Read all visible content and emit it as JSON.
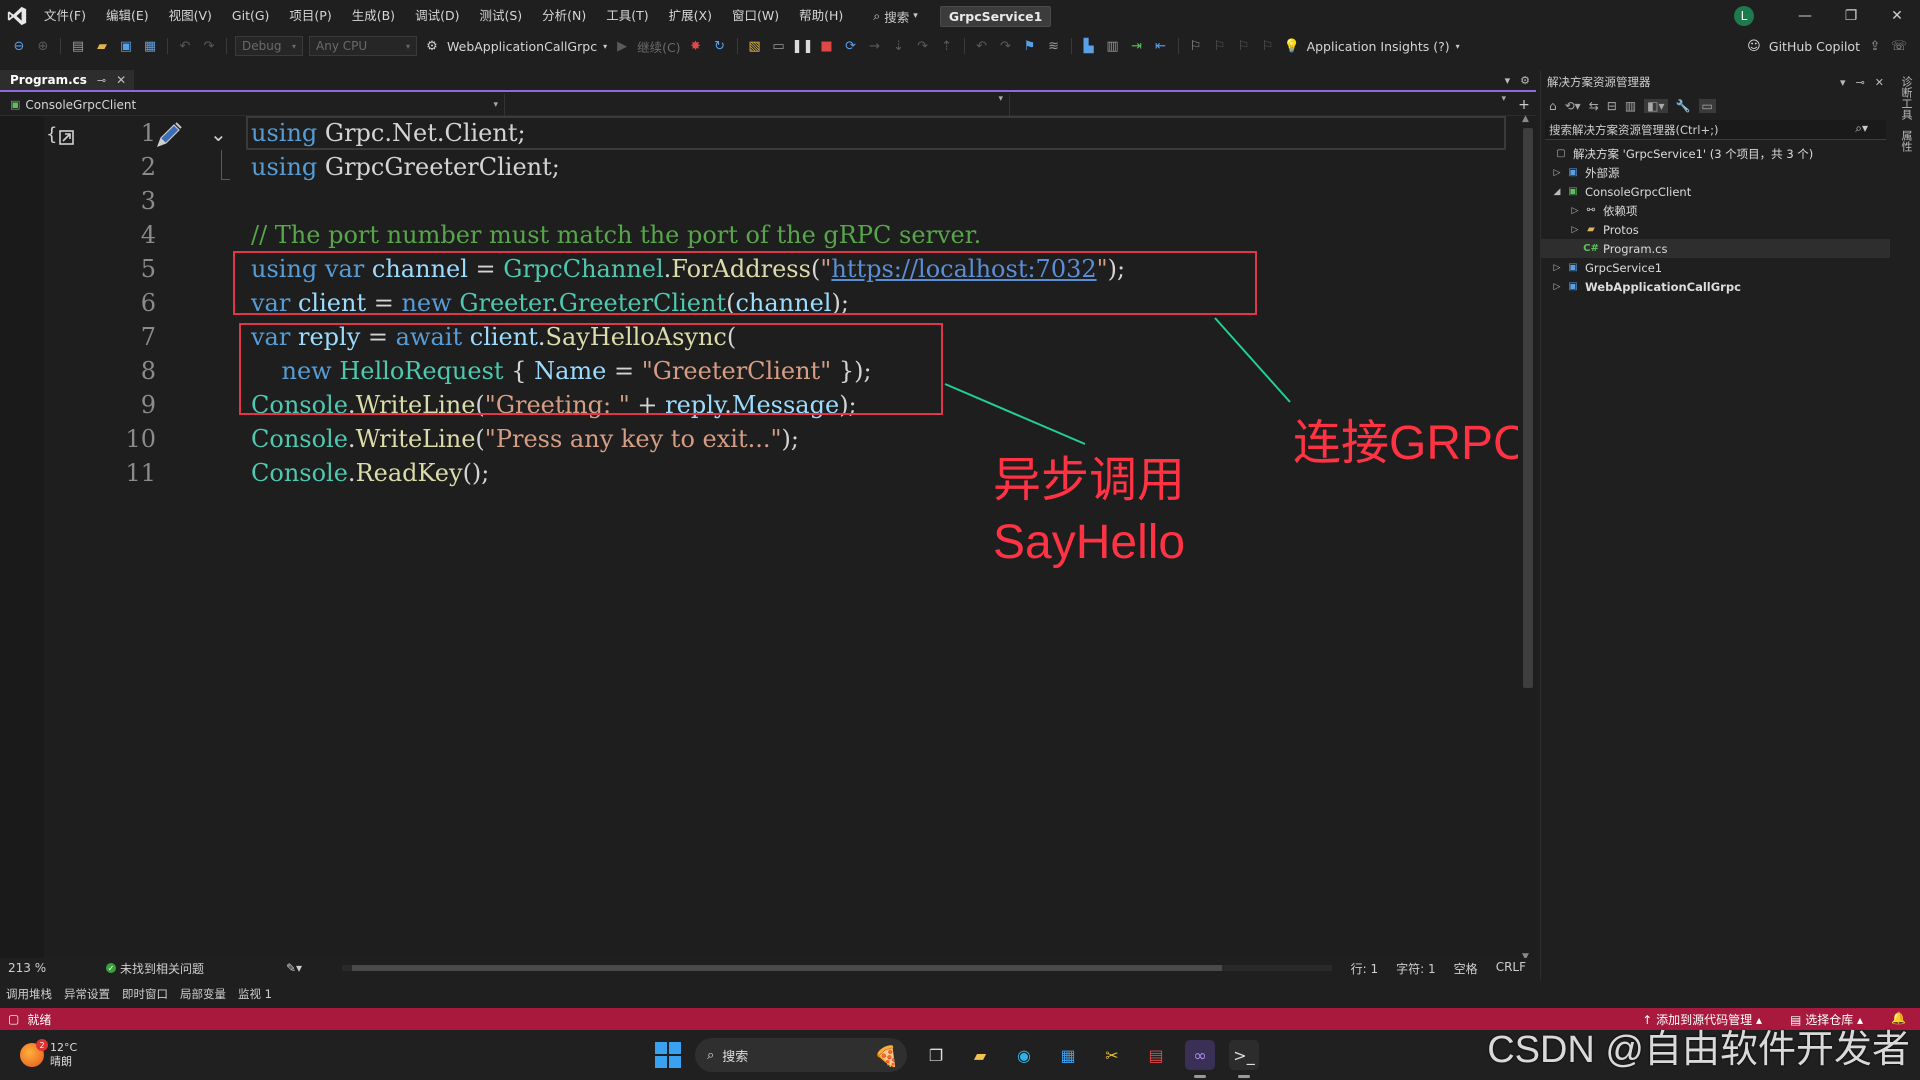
{
  "titlebar": {
    "menu": [
      "文件(F)",
      "编辑(E)",
      "视图(V)",
      "Git(G)",
      "项目(P)",
      "生成(B)",
      "调试(D)",
      "测试(S)",
      "分析(N)",
      "工具(T)",
      "扩展(X)",
      "窗口(W)",
      "帮助(H)"
    ],
    "search_label": "搜索",
    "solution_name": "GrpcService1",
    "avatar_letter": "L"
  },
  "toolbar": {
    "config": "Debug",
    "platform": "Any CPU",
    "startup_project": "WebApplicationCallGrpc",
    "continue_label": "继续(C)",
    "app_insights": "Application Insights (?)",
    "copilot": "GitHub Copilot"
  },
  "editor": {
    "tab_name": "Program.cs",
    "nav_project": "ConsoleGrpcClient",
    "line_numbers": [
      "1",
      "2",
      "3",
      "4",
      "5",
      "6",
      "7",
      "8",
      "9",
      "10",
      "11"
    ],
    "code": {
      "l1_kw": "using",
      "l1_rest": " Grpc.Net.Client;",
      "l2_kw": "using",
      "l2_rest": " GrpcGreeterClient;",
      "l4_comment": "// The port number must match the port of the gRPC server.",
      "l5_using": "using",
      "l5_var": "var",
      "l5_channel": "channel",
      "l5_eq": " = ",
      "l5_type": "GrpcChannel",
      "l5_method": "ForAddress",
      "l5_url": "https://localhost:7032",
      "l6_var": "var",
      "l6_client": "client",
      "l6_new": "new",
      "l6_type1": "Greeter",
      "l6_type2": "GreeterClient",
      "l6_arg": "channel",
      "l7_var": "var",
      "l7_reply": "reply",
      "l7_await": "await",
      "l7_client": "client",
      "l7_method": "SayHelloAsync",
      "l8_new": "new",
      "l8_type": "HelloRequest",
      "l8_name": "Name",
      "l8_str": "\"GreeterClient\"",
      "l9_type": "Console",
      "l9_method": "WriteLine",
      "l9_str": "\"Greeting: \"",
      "l9_reply": "reply",
      "l9_msg": "Message",
      "l10_type": "Console",
      "l10_method": "WriteLine",
      "l10_str": "\"Press any key to exit...\"",
      "l11_type": "Console",
      "l11_method": "ReadKey"
    },
    "annotations": {
      "connect": "连接GRPC",
      "async_line1": "异步调用",
      "async_line2": "SayHello"
    },
    "zoom": "213 %",
    "issues": "未找到相关问题",
    "row": "行: 1",
    "col": "字符: 1",
    "indent": "空格",
    "eol": "CRLF"
  },
  "bottom_tabs": [
    "调用堆栈",
    "异常设置",
    "即时窗口",
    "局部变量",
    "监视 1"
  ],
  "statusbar": {
    "ready": "就绪",
    "add_source_control": "添加到源代码管理",
    "select_repo": "选择仓库"
  },
  "solution_explorer": {
    "title": "解决方案资源管理器",
    "search_placeholder": "搜索解决方案资源管理器(Ctrl+;)",
    "solution_row": "解决方案 'GrpcService1' (3 个项目，共 3 个)",
    "items": [
      {
        "label": "外部源",
        "level": 1
      },
      {
        "label": "ConsoleGrpcClient",
        "level": 1
      },
      {
        "label": "依赖项",
        "level": 2
      },
      {
        "label": "Protos",
        "level": 2
      },
      {
        "label": "Program.cs",
        "level": 2
      },
      {
        "label": "GrpcService1",
        "level": 1
      },
      {
        "label": "WebApplicationCallGrpc",
        "level": 1
      }
    ],
    "side_tabs": [
      "诊断工具",
      "属性"
    ]
  },
  "taskbar": {
    "temperature": "12°C",
    "weather": "晴朗",
    "weather_badge": "2",
    "search": "搜索"
  },
  "watermark": "CSDN @自由软件开发者",
  "colors": {
    "status_bar": "#a8193d",
    "annotation_red": "#ff3344",
    "arrow_green": "#22d090",
    "tab_accent": "#8f6bd9"
  }
}
